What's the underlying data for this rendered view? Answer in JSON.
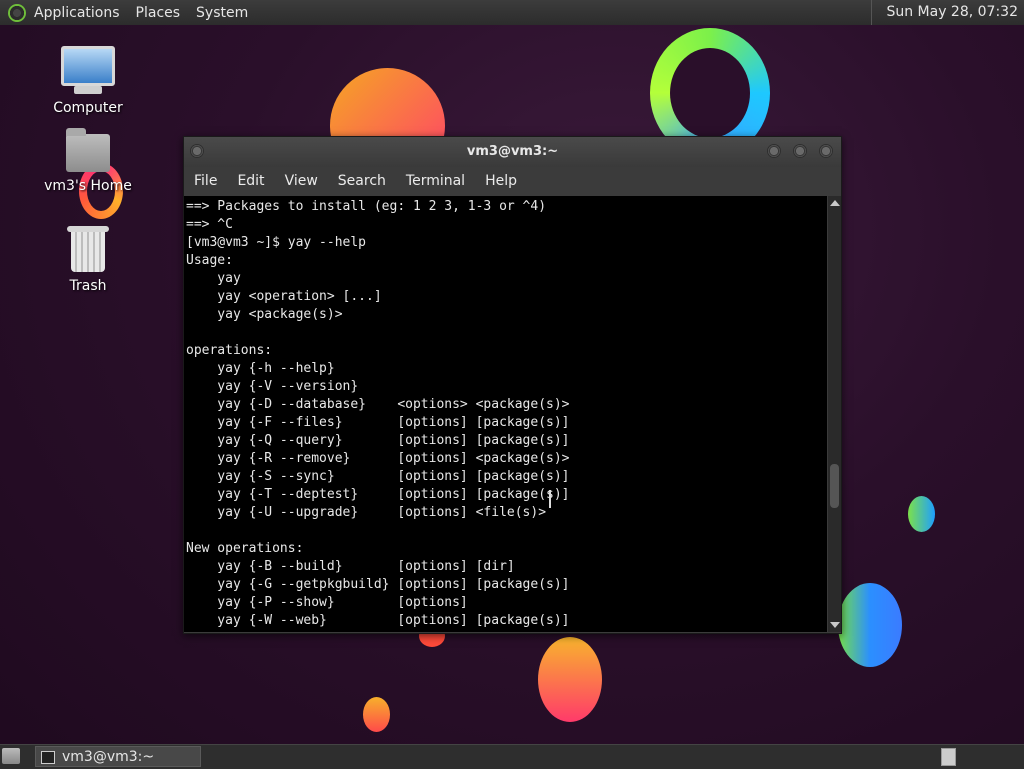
{
  "top_panel": {
    "menus": [
      "Applications",
      "Places",
      "System"
    ],
    "clock": "Sun May 28, 07:32"
  },
  "desktop": {
    "icons": [
      {
        "label": "Computer",
        "icon": "computer-icon"
      },
      {
        "label": "vm3's Home",
        "icon": "home-folder-icon"
      },
      {
        "label": "Trash",
        "icon": "trash-icon"
      }
    ]
  },
  "window": {
    "title": "vm3@vm3:~",
    "menu": [
      "File",
      "Edit",
      "View",
      "Search",
      "Terminal",
      "Help"
    ],
    "terminal_lines": [
      "==> Packages to install (eg: 1 2 3, 1-3 or ^4)",
      "==> ^C",
      "[vm3@vm3 ~]$ yay --help",
      "Usage:",
      "    yay",
      "    yay <operation> [...]",
      "    yay <package(s)>",
      "",
      "operations:",
      "    yay {-h --help}",
      "    yay {-V --version}",
      "    yay {-D --database}    <options> <package(s)>",
      "    yay {-F --files}       [options] [package(s)]",
      "    yay {-Q --query}       [options] [package(s)]",
      "    yay {-R --remove}      [options] <package(s)>",
      "    yay {-S --sync}        [options] [package(s)]",
      "    yay {-T --deptest}     [options] [package(s)]",
      "    yay {-U --upgrade}     [options] <file(s)>",
      "",
      "New operations:",
      "    yay {-B --build}       [options] [dir]",
      "    yay {-G --getpkgbuild} [options] [package(s)]",
      "    yay {-P --show}        [options]",
      "    yay {-W --web}         [options] [package(s)]"
    ]
  },
  "taskbar": {
    "task_label": "vm3@vm3:~"
  }
}
